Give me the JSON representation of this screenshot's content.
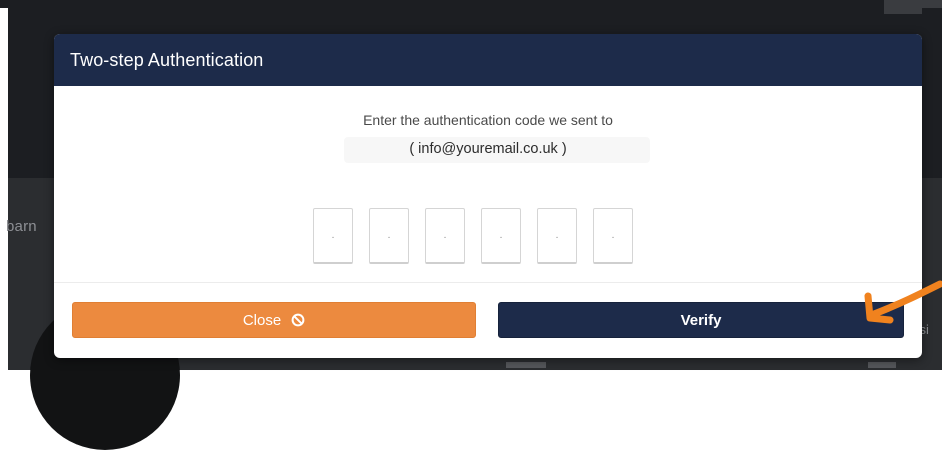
{
  "background": {
    "left_text": "barn",
    "right_text": "ssi"
  },
  "modal": {
    "title": "Two-step Authentication",
    "instruction": "Enter the authentication code we sent to",
    "email": "( info@youremail.co.uk )",
    "code_digits": [
      ".",
      ".",
      ".",
      ".",
      ".",
      "."
    ],
    "close_label": "Close",
    "close_icon": "ban-icon",
    "verify_label": "Verify"
  },
  "colors": {
    "header": "#1d2b4a",
    "close_button": "#ec8a3f",
    "verify_button": "#1d2b4a",
    "annotation_arrow": "#f0821e"
  }
}
